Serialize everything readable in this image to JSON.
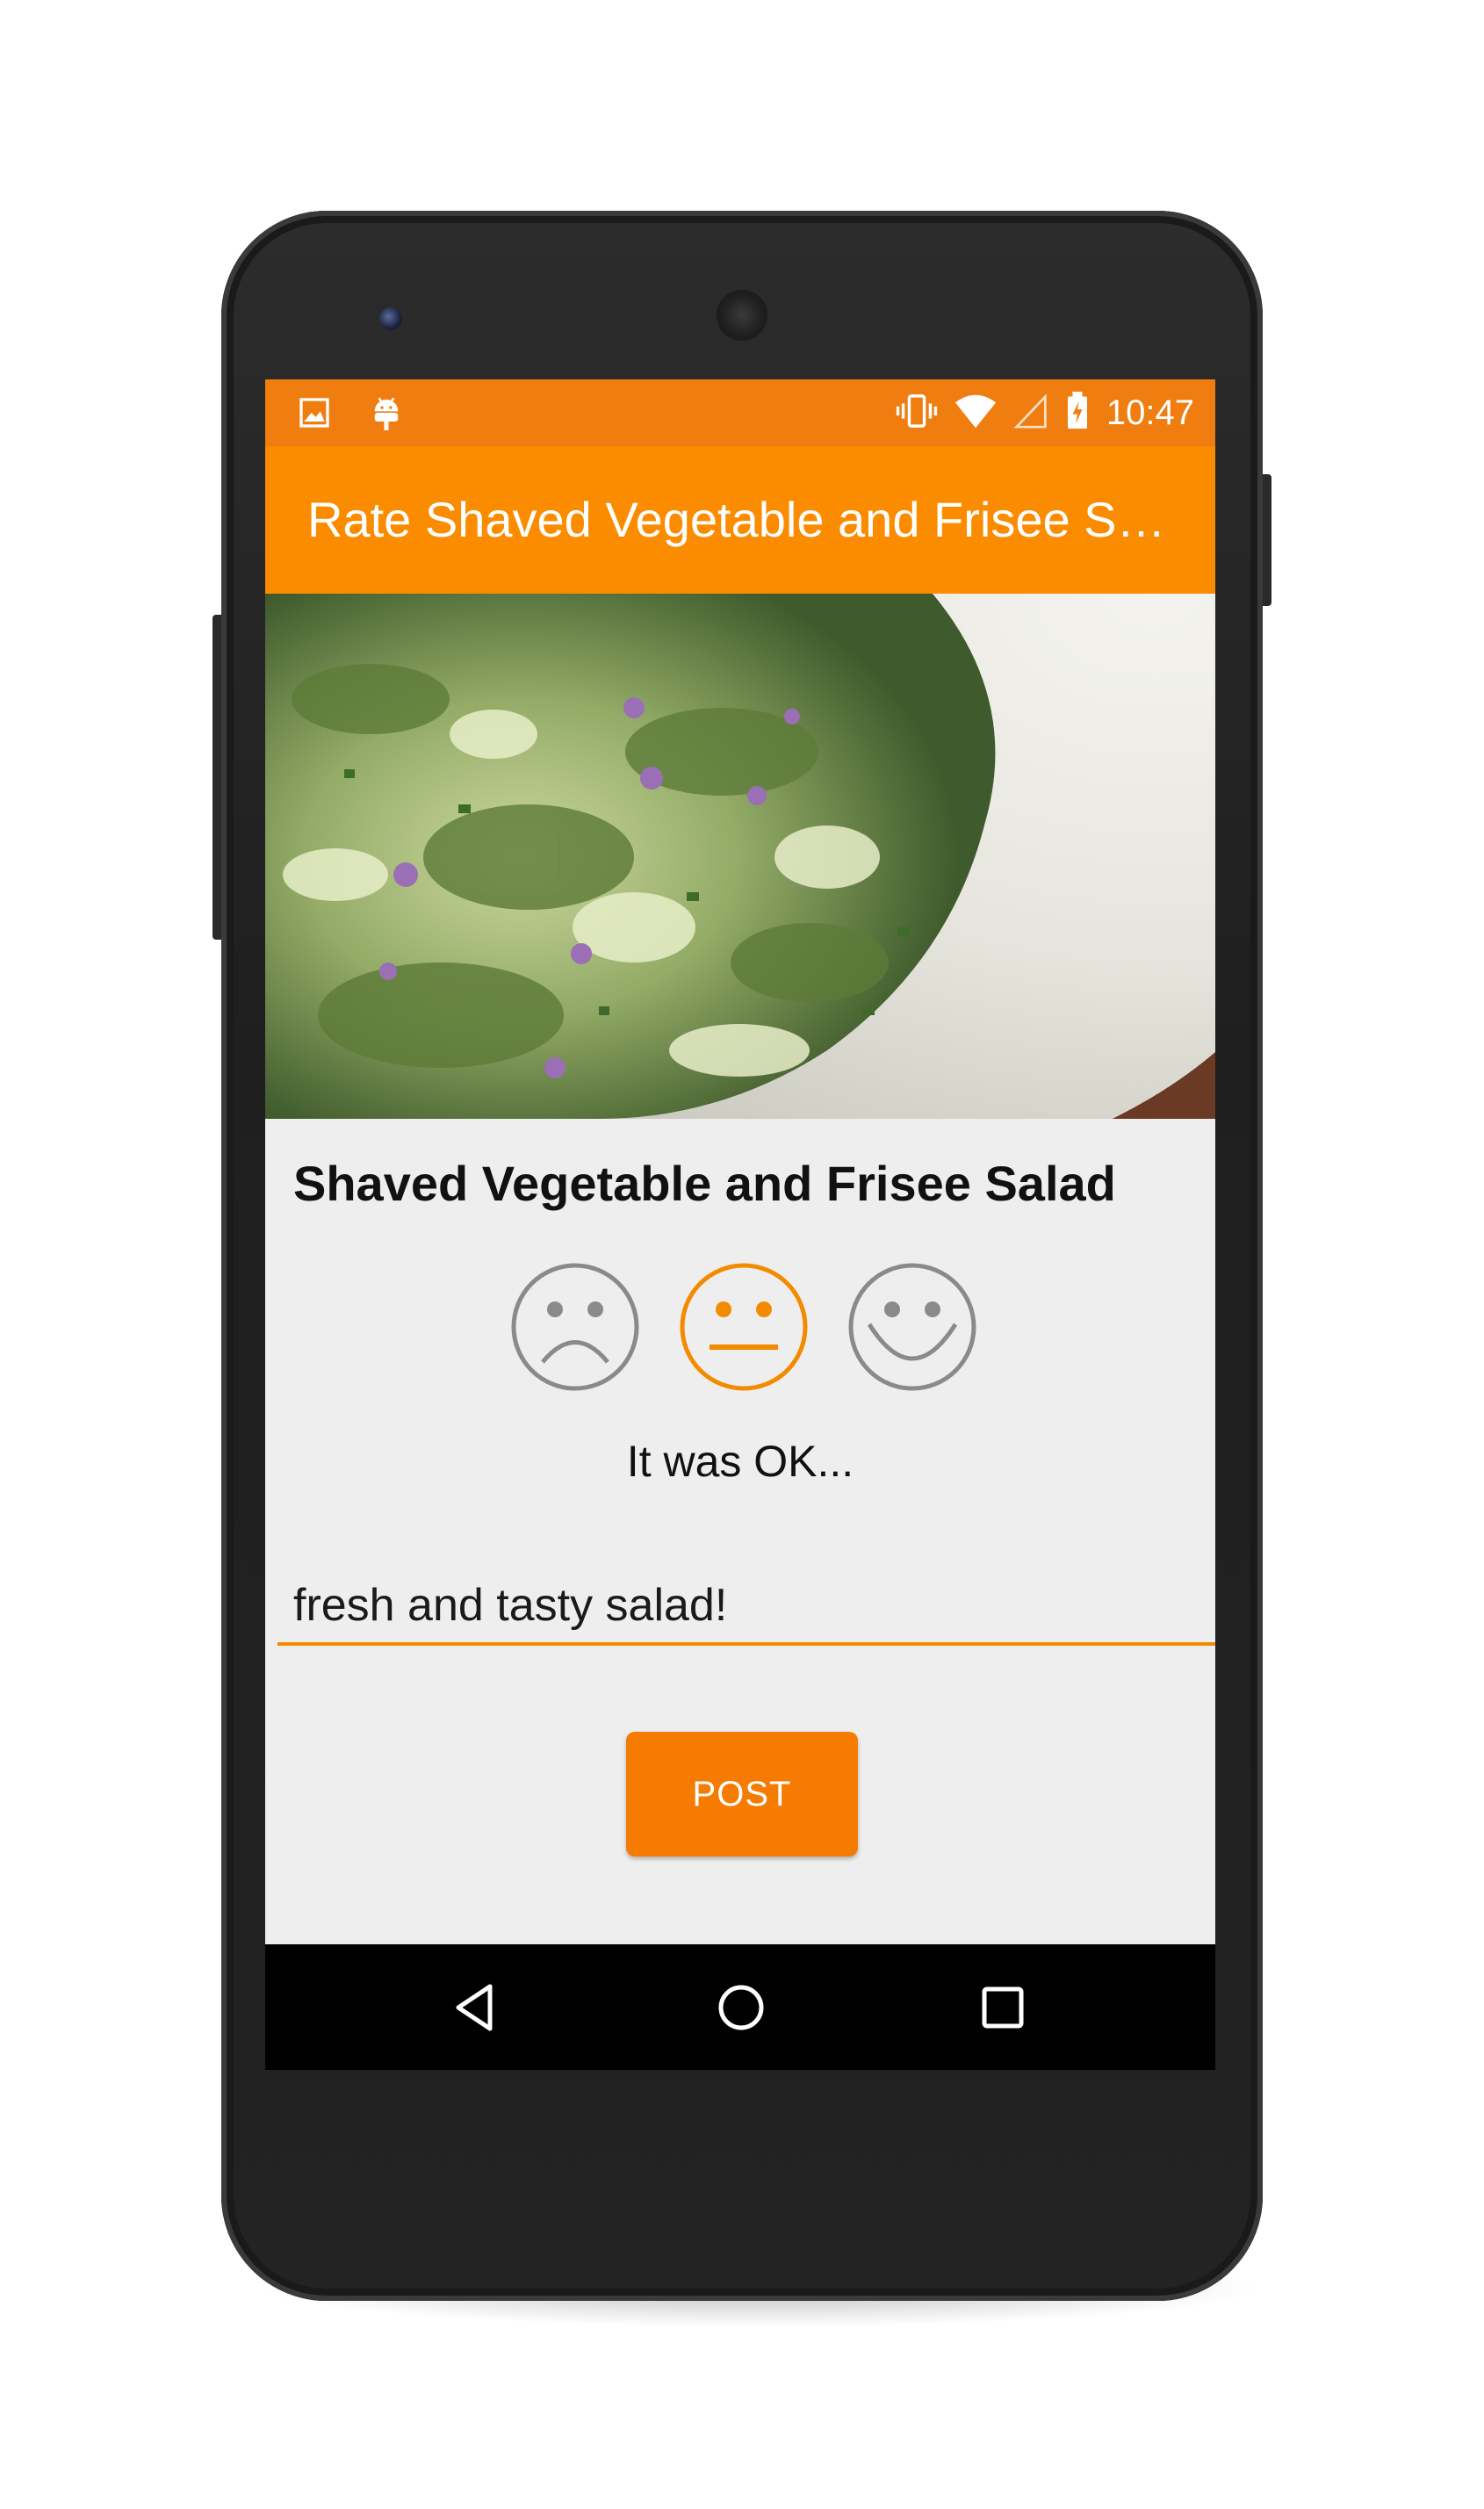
{
  "status_bar": {
    "time": "10:47",
    "icons": [
      "image-icon",
      "android-icon",
      "vibrate-icon",
      "wifi-icon",
      "signal-icon",
      "battery-charging-icon"
    ],
    "color": "#f07d10"
  },
  "app_bar": {
    "title": "Rate Shaved Vegetable and Frisee Salad",
    "color": "#fb8c00"
  },
  "recipe": {
    "name": "Shaved Vegetable and Frisee Salad",
    "image": "salad-photo"
  },
  "rating": {
    "options": [
      "sad-face-icon",
      "neutral-face-icon",
      "happy-face-icon"
    ],
    "selected": "neutral-face-icon",
    "selected_color": "#f28b00",
    "unselected_color": "#8a8a8a",
    "label": "It was OK..."
  },
  "comment": {
    "value": "fresh and tasty salad!",
    "underline_color": "#f28b00"
  },
  "post_button": {
    "label": "POST",
    "color": "#f57c00"
  },
  "nav_bar": {
    "icons": [
      "back-icon",
      "home-icon",
      "recents-icon"
    ]
  }
}
